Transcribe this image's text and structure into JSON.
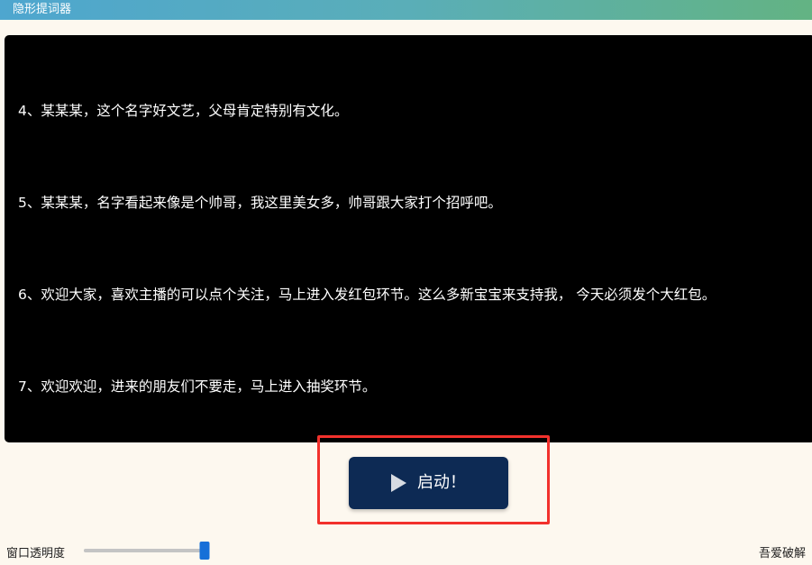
{
  "window": {
    "title": "隐形提词器"
  },
  "script_lines": [
    "4、某某某，这个名字好文艺，父母肯定特别有文化。",
    "5、某某某，名字看起来像是个帅哥，我这里美女多，帅哥跟大家打个招呼吧。",
    "6、欢迎大家，喜欢主播的可以点个关注，马上进入发红包环节。这么多新宝宝来支持我， 今天必须发个大红包。",
    "7、欢迎欢迎，进来的朋友们不要走，马上进入抽奖环节。"
  ],
  "controls": {
    "start_label": "启动！",
    "start_icon": "play-icon",
    "opacity_label": "窗口透明度",
    "opacity_value": 1.0,
    "credit_text": "吾爱破解"
  },
  "colors": {
    "panel_background": "#000000",
    "button_background": "#0d2a54",
    "highlight_border": "#f2312c",
    "slider_thumb": "#1670d8"
  }
}
